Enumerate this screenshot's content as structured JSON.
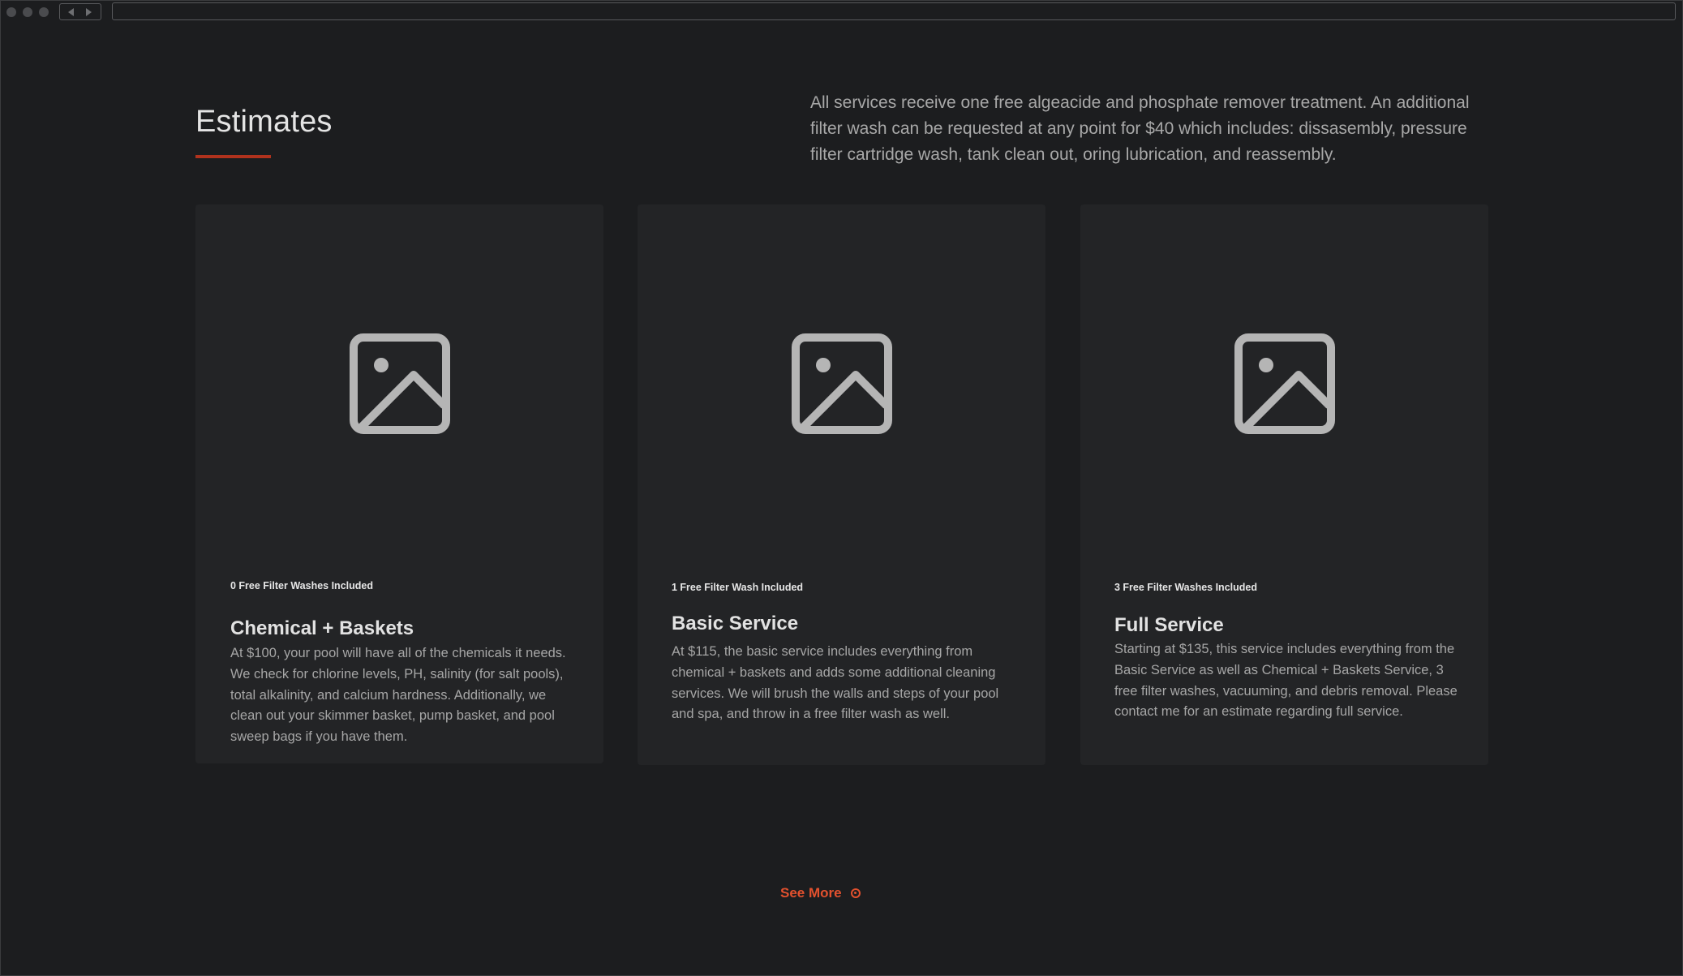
{
  "browser": {
    "window_controls": [
      "close",
      "minimize",
      "maximize"
    ],
    "nav": {
      "back_icon": "back-arrow-icon",
      "forward_icon": "forward-arrow-icon"
    },
    "url": ""
  },
  "header": {
    "title": "Estimates",
    "intro": "All services receive one free algeacide and phosphate remover treatment. An additional filter wash can be requested at any point for $40 which includes: dissasembly, pressure filter cartridge wash, tank clean out, oring lubrication, and reassembly."
  },
  "cards": [
    {
      "image_icon": "image-placeholder-icon",
      "badge": "0 Free Filter Washes Included",
      "title": "Chemical + Baskets",
      "description": "At $100, your pool will have all of the chemicals it needs. We check for chlorine levels, PH, salinity (for salt pools), total alkalinity, and calcium hardness. Additionally, we clean out your skimmer basket, pump basket, and pool sweep bags if you have them."
    },
    {
      "image_icon": "image-placeholder-icon",
      "badge": "1 Free Filter Wash Included",
      "title": "Basic Service",
      "description": "At $115, the basic service includes everything from chemical + baskets and adds some additional cleaning services. We will brush the walls and steps of your pool and spa, and throw in a free filter wash as well."
    },
    {
      "image_icon": "image-placeholder-icon",
      "badge": "3 Free Filter Washes Included",
      "title": "Full Service",
      "description": "Starting at $135, this service includes everything from the Basic Service as well as Chemical + Baskets Service, 3 free filter washes, vacuuming, and debris removal. Please contact me for an estimate regarding full service."
    }
  ],
  "see_more": {
    "label": "See More",
    "icon": "circle-arrow-icon"
  },
  "colors": {
    "background": "#1c1d1f",
    "card": "#232426",
    "accent": "#e3512e",
    "underline": "#b0321d",
    "heading": "#e4e4e4",
    "body_text": "#a8a8a8",
    "icon": "#b5b5b5"
  }
}
